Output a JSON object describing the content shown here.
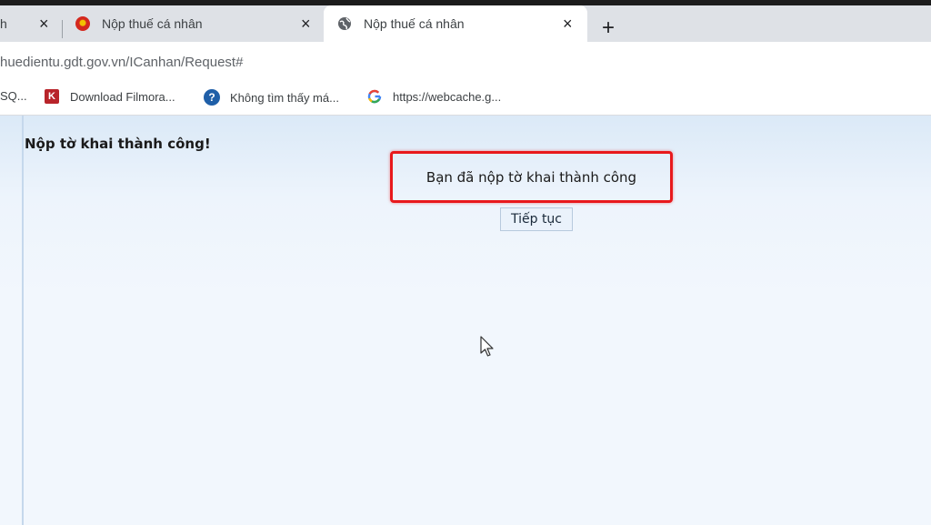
{
  "browser": {
    "tabs": [
      {
        "label": "h",
        "close": "×"
      },
      {
        "label": "Nộp thuế cá nhân",
        "close": "×"
      },
      {
        "label": "Nộp thuế cá nhân",
        "close": "×",
        "active": true
      }
    ],
    "new_tab": "+",
    "url": "huedientu.gdt.gov.vn/ICanhan/Request#",
    "bookmarks": [
      {
        "label": "SQ...",
        "icon": "bookmark-icon"
      },
      {
        "label": "Download Filmora...",
        "icon": "k-logo-icon"
      },
      {
        "label": "Không tìm thấy má...",
        "icon": "help-circle-icon"
      },
      {
        "label": "https://webcache.g...",
        "icon": "google-g-icon"
      }
    ]
  },
  "page": {
    "title": "Nộp tờ khai thành công!",
    "notice": "Bạn đã nộp tờ khai thành công",
    "continue_label": "Tiếp tục"
  },
  "colors": {
    "highlight_border": "#e8191c",
    "content_bg": "#f2f7fd",
    "tabstrip_bg": "#dee1e6"
  }
}
